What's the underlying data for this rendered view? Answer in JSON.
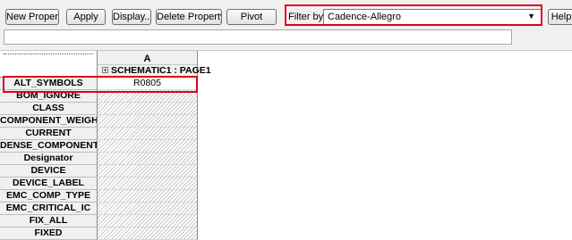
{
  "toolbar": {
    "new_property_label": "New Property...",
    "apply_label": "Apply",
    "display_label": "Display...",
    "delete_property_label": "Delete Property",
    "pivot_label": "Pivot",
    "filter_label": "Filter by:",
    "filter_value": "Cadence-Allegro",
    "help_label": "Help"
  },
  "text_field": {
    "value": ""
  },
  "grid": {
    "column_letter": "A",
    "column_name": "SCHEMATIC1 : PAGE1",
    "rows": [
      {
        "name": "ALT_SYMBOLS",
        "value": "R0805"
      },
      {
        "name": "BOM_IGNORE",
        "value": ""
      },
      {
        "name": "CLASS",
        "value": ""
      },
      {
        "name": "COMPONENT_WEIGHT",
        "value": ""
      },
      {
        "name": "CURRENT",
        "value": ""
      },
      {
        "name": "DENSE_COMPONENT",
        "value": ""
      },
      {
        "name": "Designator",
        "value": ""
      },
      {
        "name": "DEVICE",
        "value": ""
      },
      {
        "name": "DEVICE_LABEL",
        "value": ""
      },
      {
        "name": "EMC_COMP_TYPE",
        "value": ""
      },
      {
        "name": "EMC_CRITICAL_IC",
        "value": ""
      },
      {
        "name": "FIX_ALL",
        "value": ""
      },
      {
        "name": "FIXED",
        "value": ""
      }
    ]
  },
  "colors": {
    "highlight": "#e0001b",
    "header_bg": "#f0f0f0"
  }
}
